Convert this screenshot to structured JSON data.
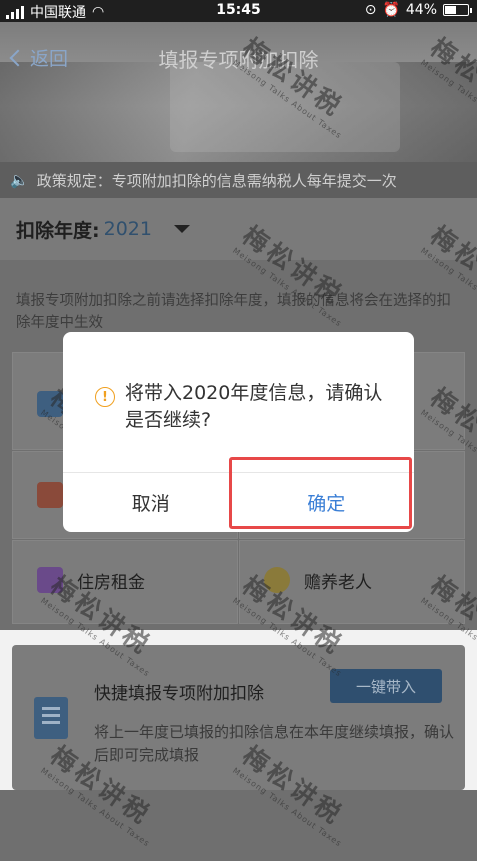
{
  "status_bar": {
    "carrier": "中国联通",
    "time": "15:45",
    "battery": "44%"
  },
  "header": {
    "back_label": "返回",
    "title": "填报专项附加扣除"
  },
  "notice": {
    "text": "政策规定：专项附加扣除的信息需纳税人每年提交一次"
  },
  "year": {
    "label": "扣除年度:",
    "value": "2021"
  },
  "description": "填报专项附加扣除之前请选择扣除年度，填报的信息将会在选择的扣除年度中生效",
  "grid_items": [
    {
      "label": "住房租金"
    },
    {
      "label": "赡养老人"
    }
  ],
  "quick": {
    "title": "快捷填报专项附加扣除",
    "button": "一键带入",
    "desc": "将上一年度已填报的扣除信息在本年度继续填报，确认后即可完成填报"
  },
  "dialog": {
    "message": "将带入2020年度信息，请确认是否继续?",
    "cancel": "取消",
    "confirm": "确定"
  },
  "watermark": {
    "text": "梅松讲税",
    "sub": "Meisong Talks About Taxes"
  },
  "colors": {
    "accent": "#3b7fd6",
    "warn": "#f0a020",
    "highlight": "#e74848"
  }
}
